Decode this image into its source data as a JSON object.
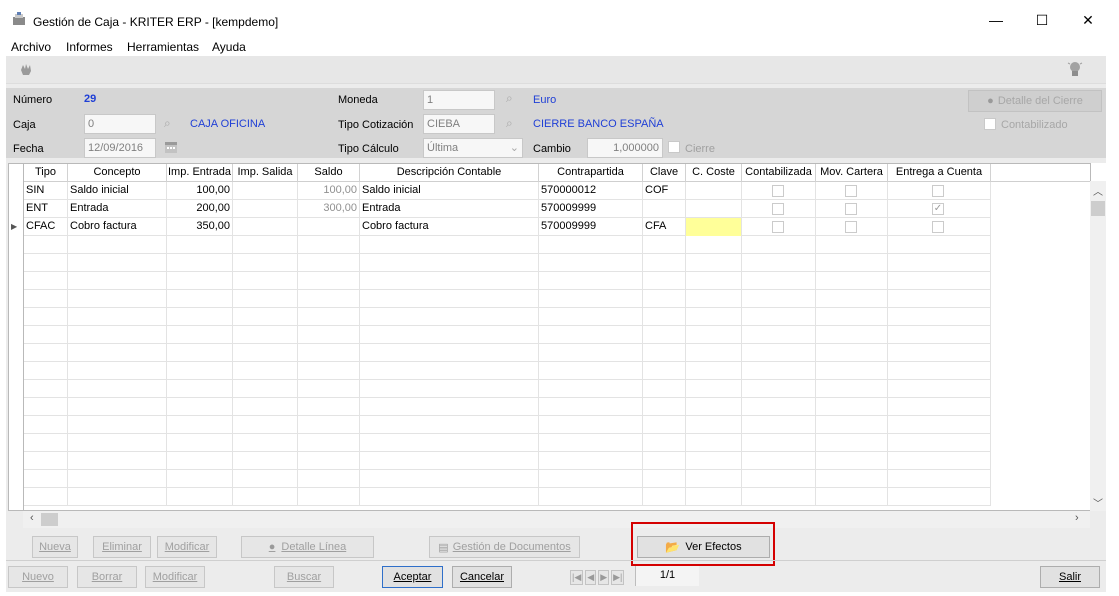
{
  "window": {
    "title": "Gestión de Caja - KRITER ERP - [kempdemo]",
    "minimize": "—",
    "maximize": "☐",
    "close": "✕"
  },
  "menu": [
    "Archivo",
    "Informes",
    "Herramientas",
    "Ayuda"
  ],
  "header": {
    "numero_label": "Número",
    "numero_value": "29",
    "caja_label": "Caja",
    "caja_value": "0",
    "caja_name": "CAJA OFICINA",
    "fecha_label": "Fecha",
    "fecha_value": "12/09/2016",
    "moneda_label": "Moneda",
    "moneda_value": "1",
    "moneda_name": "Euro",
    "tipo_cotizacion_label": "Tipo Cotización",
    "tipo_cotizacion_value": "CIEBA",
    "tipo_cotizacion_name": "CIERRE BANCO ESPAÑA",
    "tipo_calculo_label": "Tipo Cálculo",
    "tipo_calculo_value": "Última",
    "cambio_label": "Cambio",
    "cambio_value": "1,000000",
    "cierre_label": "Cierre",
    "detalle_cierre_label": "Detalle del Cierre",
    "contabilizado_label": "Contabilizado"
  },
  "grid": {
    "columns": [
      "Tipo",
      "Concepto",
      "Imp. Entrada",
      "Imp. Salida",
      "Saldo",
      "Descripción Contable",
      "Contrapartida",
      "Clave",
      "C. Coste",
      "Contabilizada",
      "Mov. Cartera",
      "Entrega a Cuenta"
    ],
    "rows": [
      {
        "tipo": "SIN",
        "concepto": "Saldo inicial",
        "entrada": "100,00",
        "salida": "",
        "saldo": "100,00",
        "descripcion": "Saldo inicial",
        "contrapartida": "570000012",
        "clave": "COF",
        "ccoste": "",
        "contabilizada": false,
        "cartera": false,
        "entrega": false
      },
      {
        "tipo": "ENT",
        "concepto": "Entrada",
        "entrada": "200,00",
        "salida": "",
        "saldo": "300,00",
        "descripcion": "Entrada",
        "contrapartida": "570009999",
        "clave": "",
        "ccoste": "",
        "contabilizada": false,
        "cartera": false,
        "entrega": true
      },
      {
        "tipo": "CFAC",
        "concepto": "Cobro factura",
        "entrada": "350,00",
        "salida": "",
        "saldo": "",
        "descripcion": "Cobro factura",
        "contrapartida": "570009999",
        "clave": "CFA",
        "ccoste": "",
        "contabilizada": false,
        "cartera": false,
        "entrega": false
      }
    ],
    "row_marker": "▶"
  },
  "line_buttons": {
    "nueva": "Nueva",
    "eliminar": "Eliminar",
    "modificar": "Modificar",
    "detalle_linea": "Detalle Línea",
    "gestion_documentos": "Gestión de Documentos",
    "ver_efectos": "Ver Efectos"
  },
  "bottom_buttons": {
    "nuevo": "Nuevo",
    "borrar": "Borrar",
    "modificar": "Modificar",
    "buscar": "Buscar",
    "aceptar": "Aceptar",
    "cancelar": "Cancelar",
    "salir": "Salir"
  },
  "pager": {
    "first": "|◀",
    "prev": "◀",
    "next": "▶",
    "last": "▶|",
    "position": "1/1"
  },
  "colors": {
    "highlight_box": "#d40000",
    "blue_text": "#1f3fd6",
    "selected_cell": "#ffff99"
  }
}
